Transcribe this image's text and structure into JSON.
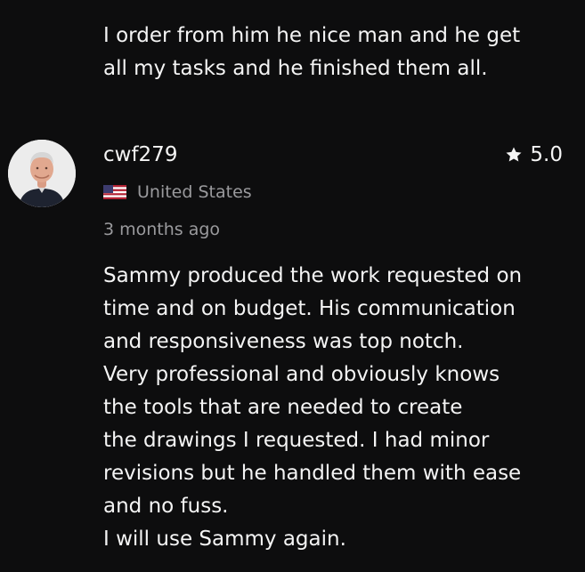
{
  "previous_review": {
    "lines": [
      "I order from him he nice man and he get",
      "all my tasks and he finished them all."
    ]
  },
  "review": {
    "avatar_icon": "avatar-photo",
    "reviewer": "cwf279",
    "rating": {
      "icon": "star-icon",
      "value": "5.0"
    },
    "country": {
      "flag_icon": "us-flag-icon",
      "name": "United States"
    },
    "time_ago": "3 months ago",
    "body_lines": [
      "Sammy produced the work requested on",
      "time and on budget. His communication",
      "and responsiveness was top notch.",
      "Very professional and obviously knows",
      "the tools that are needed to create",
      "the drawings I requested. I had minor",
      "revisions but he handled them with ease",
      "and no fuss.",
      "I will use Sammy again."
    ]
  }
}
